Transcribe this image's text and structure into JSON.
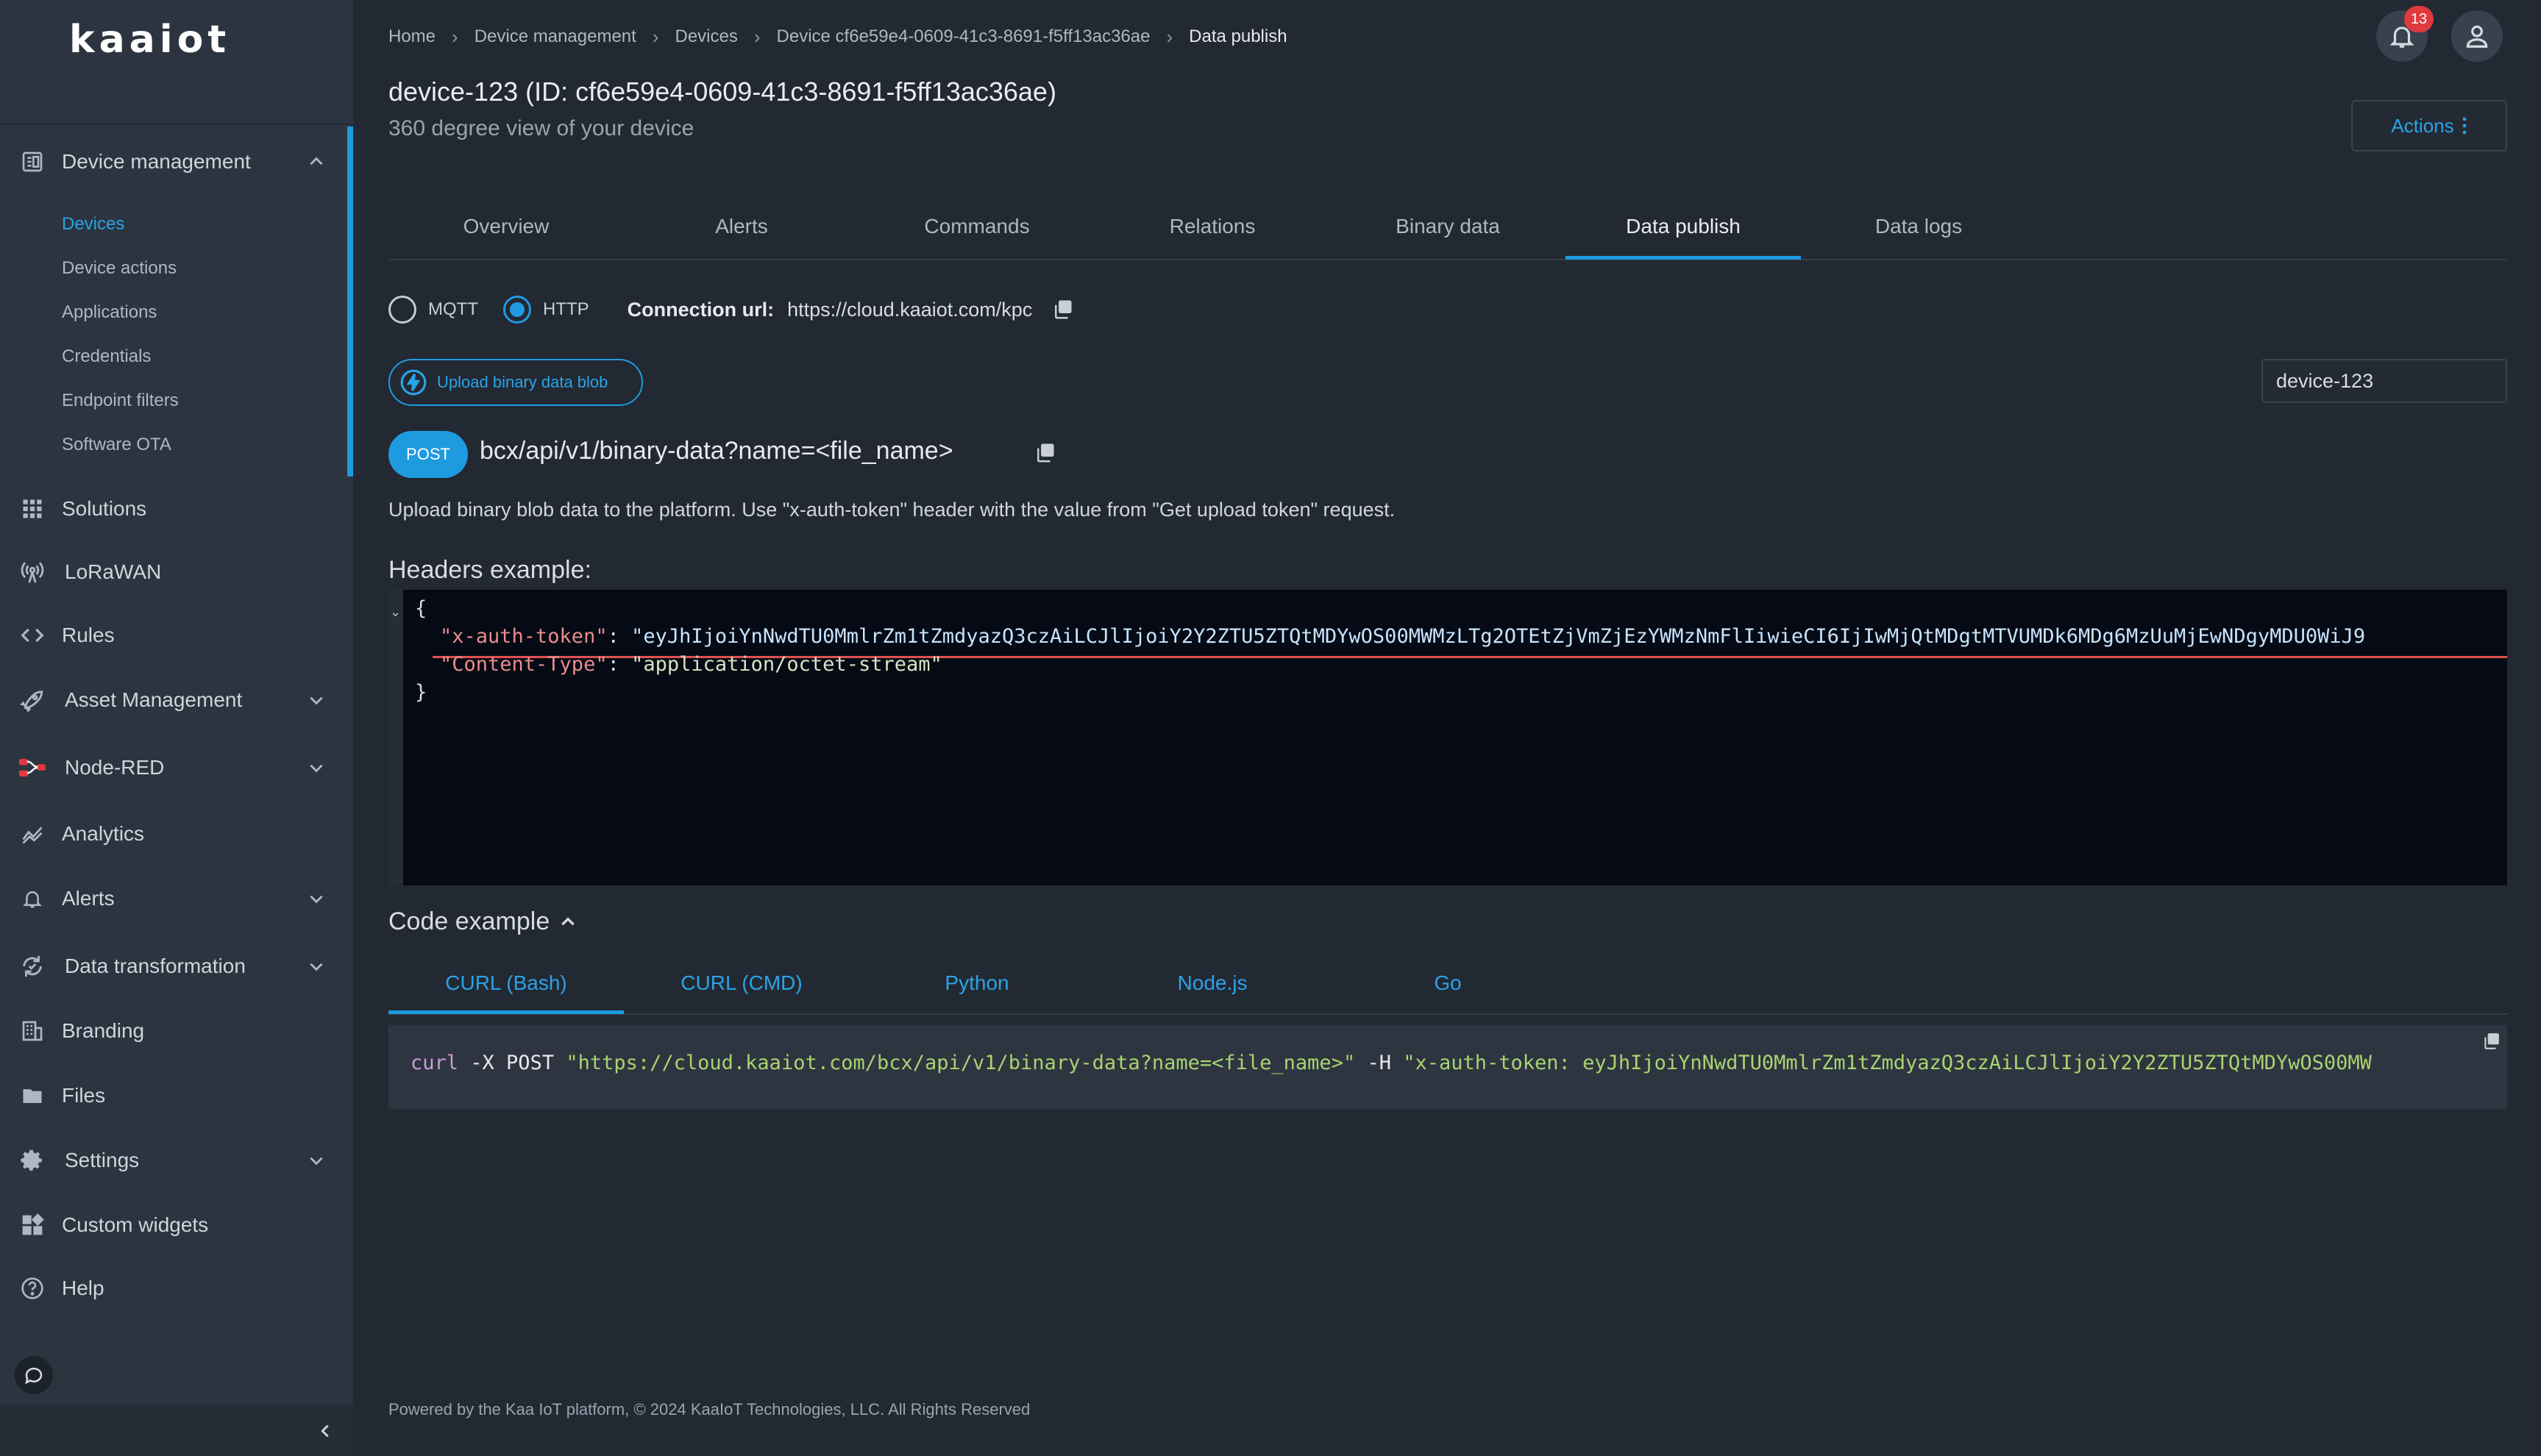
{
  "brand": {
    "logo_text": "kaaiot"
  },
  "sidebar": {
    "sections": [
      {
        "label": "Device management",
        "icon": "device-management-icon",
        "expanded": true
      },
      {
        "label": "Solutions",
        "icon": "grid-icon"
      },
      {
        "label": "LoRaWAN",
        "icon": "antenna-icon"
      },
      {
        "label": "Rules",
        "icon": "code-icon"
      },
      {
        "label": "Asset Management",
        "icon": "rocket-icon",
        "expandable": true
      },
      {
        "label": "Node-RED",
        "icon": "node-red-icon",
        "expandable": true
      },
      {
        "label": "Analytics",
        "icon": "analytics-icon"
      },
      {
        "label": "Alerts",
        "icon": "bell-icon",
        "expandable": true
      },
      {
        "label": "Data transformation",
        "icon": "transform-icon",
        "expandable": true
      },
      {
        "label": "Branding",
        "icon": "building-icon"
      },
      {
        "label": "Files",
        "icon": "folder-icon"
      },
      {
        "label": "Settings",
        "icon": "gear-icon",
        "expandable": true
      },
      {
        "label": "Custom widgets",
        "icon": "widgets-icon"
      },
      {
        "label": "Help",
        "icon": "help-icon"
      }
    ],
    "device_management_items": [
      "Devices",
      "Device actions",
      "Applications",
      "Credentials",
      "Endpoint filters",
      "Software OTA"
    ],
    "active_item": "Devices"
  },
  "header": {
    "breadcrumb": [
      "Home",
      "Device management",
      "Devices",
      "Device cf6e59e4-0609-41c3-8691-f5ff13ac36ae",
      "Data publish"
    ],
    "notification_count": "13",
    "title": "device-123 (ID: cf6e59e4-0609-41c3-8691-f5ff13ac36ae)",
    "subtitle": "360 degree view of your device",
    "actions_label": "Actions"
  },
  "tabs": [
    "Overview",
    "Alerts",
    "Commands",
    "Relations",
    "Binary data",
    "Data publish",
    "Data logs"
  ],
  "active_tab": "Data publish",
  "protocol": {
    "options": [
      "MQTT",
      "HTTP"
    ],
    "selected": "HTTP"
  },
  "connection": {
    "label": "Connection url:",
    "url": "https://cloud.kaaiot.com/kpc"
  },
  "upload_button": "Upload binary data blob",
  "device_select": "device-123",
  "request": {
    "method": "POST",
    "endpoint": "bcx/api/v1/binary-data?name=<file_name>",
    "description": "Upload binary blob data to the platform. Use \"x-auth-token\" header with the value from \"Get upload token\" request."
  },
  "headers_example": {
    "title": "Headers example:",
    "open_brace": "{",
    "close_brace": "}",
    "line1_key": "\"x-auth-token\"",
    "line1_sep": ": ",
    "line1_value": "\"eyJhIjoiYnNwdTU0MmlrZm1tZmdyazQ3czAiLCJlIjoiY2Y2ZTU5ZTQtMDYwOS00MWMzLTg2OTEtZjVmZjEzYWMzNmFlIiwieCI6IjIwMjQtMDgtMTVUMDk6MDg6MzUuMjEwNDgyMDU0WiJ9",
    "line2_key": "\"Content-Type\"",
    "line2_sep": ": ",
    "line2_value": "\"application/octet-stream\""
  },
  "code_example": {
    "title": "Code example",
    "tabs": [
      "CURL (Bash)",
      "CURL (CMD)",
      "Python",
      "Node.js",
      "Go"
    ],
    "active_tab": "CURL (Bash)",
    "cmd_name": "curl",
    "cmd_flag": " -X POST ",
    "cmd_url": "\"https://cloud.kaaiot.com/bcx/api/v1/binary-data?name=<file_name>\"",
    "cmd_h": " -H ",
    "cmd_header": "\"x-auth-token: eyJhIjoiYnNwdTU0MmlrZm1tZmdyazQ3czAiLCJlIjoiY2Y2ZTU5ZTQtMDYwOS00MW"
  },
  "footer": "Powered by the Kaa IoT platform, © 2024 KaaIoT Technologies, LLC. All Rights Reserved",
  "colors": {
    "accent": "#1e9be0",
    "sidebar": "#2c3440",
    "background": "#222933",
    "badge": "#e0393e"
  }
}
